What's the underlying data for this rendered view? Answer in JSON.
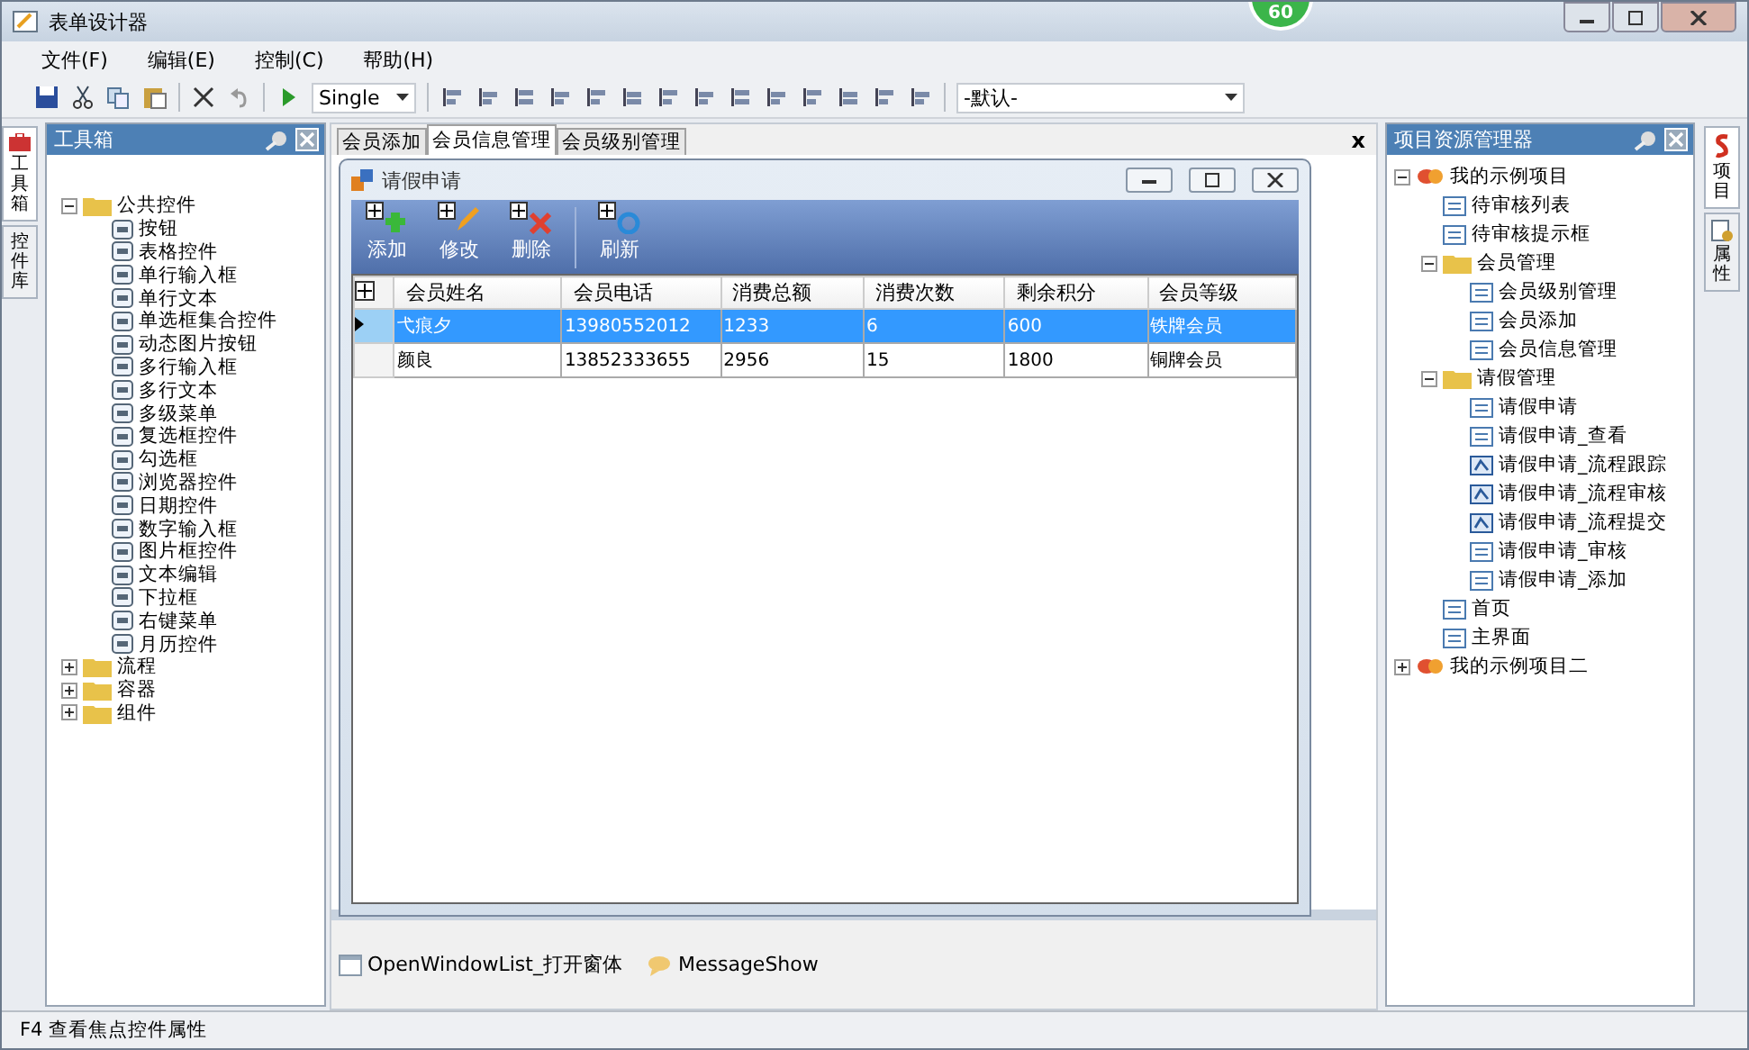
{
  "window": {
    "title": "表单设计器",
    "badge": "60"
  },
  "menu": [
    "文件(F)",
    "编辑(E)",
    "控制(C)",
    "帮助(H)"
  ],
  "toolbar": {
    "mode_select": "Single",
    "style_select": "-默认-"
  },
  "left_tabs": [
    {
      "label": "工具箱",
      "selected": true
    },
    {
      "label": "控件库",
      "selected": false
    }
  ],
  "toolbox": {
    "title": "工具箱",
    "tree": [
      {
        "label": "公共控件",
        "kind": "folder",
        "expanded": true,
        "children": [
          {
            "label": "按钮",
            "kind": "control"
          },
          {
            "label": "表格控件",
            "kind": "control"
          },
          {
            "label": "单行输入框",
            "kind": "control"
          },
          {
            "label": "单行文本",
            "kind": "control"
          },
          {
            "label": "单选框集合控件",
            "kind": "control"
          },
          {
            "label": "动态图片按钮",
            "kind": "control"
          },
          {
            "label": "多行输入框",
            "kind": "control"
          },
          {
            "label": "多行文本",
            "kind": "control"
          },
          {
            "label": "多级菜单",
            "kind": "control"
          },
          {
            "label": "复选框控件",
            "kind": "control"
          },
          {
            "label": "勾选框",
            "kind": "control"
          },
          {
            "label": "浏览器控件",
            "kind": "control"
          },
          {
            "label": "日期控件",
            "kind": "control"
          },
          {
            "label": "数字输入框",
            "kind": "control"
          },
          {
            "label": "图片框控件",
            "kind": "control"
          },
          {
            "label": "文本编辑",
            "kind": "control"
          },
          {
            "label": "下拉框",
            "kind": "control"
          },
          {
            "label": "右键菜单",
            "kind": "control"
          },
          {
            "label": "月历控件",
            "kind": "control"
          }
        ]
      },
      {
        "label": "流程",
        "kind": "folder",
        "expanded": false
      },
      {
        "label": "容器",
        "kind": "folder",
        "expanded": false
      },
      {
        "label": "组件",
        "kind": "folder",
        "expanded": false
      }
    ]
  },
  "doc_tabs": [
    {
      "label": "会员添加",
      "selected": false
    },
    {
      "label": "会员信息管理",
      "selected": true
    },
    {
      "label": "会员级别管理",
      "selected": false
    }
  ],
  "doc_close": "x",
  "form": {
    "title": "请假申请",
    "buttons": [
      {
        "label": "添加",
        "kind": "add"
      },
      {
        "label": "修改",
        "kind": "edit"
      },
      {
        "label": "删除",
        "kind": "delete"
      },
      {
        "label": "刷新",
        "kind": "refresh"
      }
    ],
    "table": {
      "columns": [
        "会员姓名",
        "会员电话",
        "消费总额",
        "消费次数",
        "剩余积分",
        "会员等级"
      ],
      "rows": [
        {
          "cells": [
            "弋痕夕",
            "13980552012",
            "1233",
            "6",
            "600",
            "铁牌会员"
          ],
          "selected": true
        },
        {
          "cells": [
            "颜良",
            "13852333655",
            "2956",
            "15",
            "1800",
            "铜牌会员"
          ],
          "selected": false
        }
      ]
    }
  },
  "components": [
    {
      "label": "OpenWindowList_打开窗体",
      "kind": "window"
    },
    {
      "label": "MessageShow",
      "kind": "message"
    }
  ],
  "project": {
    "title": "项目资源管理器",
    "tree": [
      {
        "label": "我的示例项目",
        "kind": "project",
        "expanded": true,
        "children": [
          {
            "label": "待审核列表",
            "kind": "form"
          },
          {
            "label": "待审核提示框",
            "kind": "form"
          },
          {
            "label": "会员管理",
            "kind": "folder",
            "expanded": true,
            "children": [
              {
                "label": "会员级别管理",
                "kind": "form"
              },
              {
                "label": "会员添加",
                "kind": "form"
              },
              {
                "label": "会员信息管理",
                "kind": "form"
              }
            ]
          },
          {
            "label": "请假管理",
            "kind": "folder",
            "expanded": true,
            "children": [
              {
                "label": "请假申请",
                "kind": "form"
              },
              {
                "label": "请假申请_查看",
                "kind": "form"
              },
              {
                "label": "请假申请_流程跟踪",
                "kind": "flow"
              },
              {
                "label": "请假申请_流程审核",
                "kind": "flow"
              },
              {
                "label": "请假申请_流程提交",
                "kind": "flow"
              },
              {
                "label": "请假申请_审核",
                "kind": "form"
              },
              {
                "label": "请假申请_添加",
                "kind": "form"
              }
            ]
          },
          {
            "label": "首页",
            "kind": "form"
          },
          {
            "label": "主界面",
            "kind": "form"
          }
        ]
      },
      {
        "label": "我的示例项目二",
        "kind": "project",
        "expanded": false
      }
    ]
  },
  "right_tabs": [
    {
      "label": "项目",
      "selected": true
    },
    {
      "label": "属性",
      "selected": false
    }
  ],
  "status_bar": "F4 查看焦点控件属性"
}
